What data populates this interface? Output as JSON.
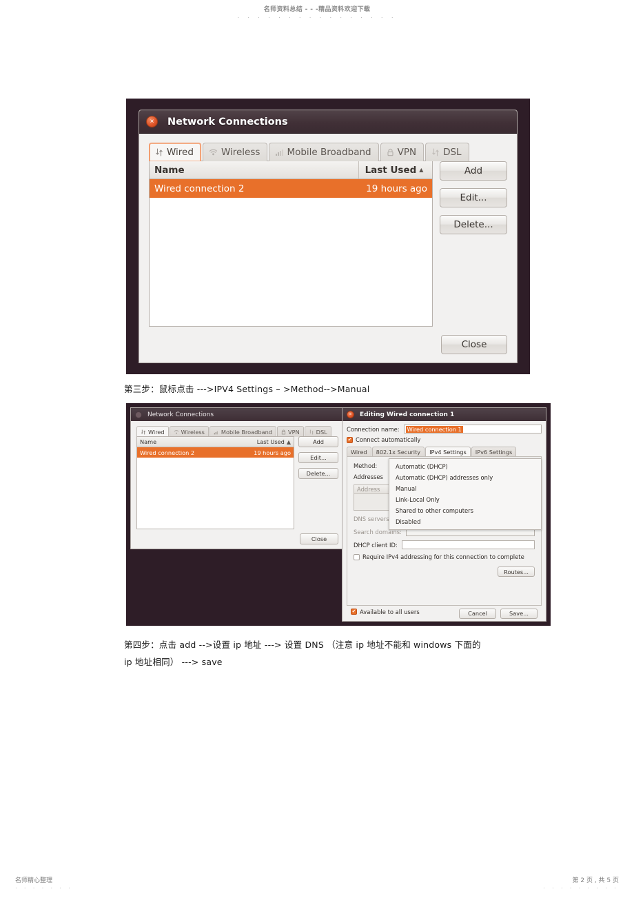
{
  "document": {
    "header_watermark": "名师资料总结 - - -精品资料欢迎下载",
    "header_dots": "· · · · · · · · · · · · · · · ·",
    "footer_left": "名师精心整理",
    "footer_left_dots": "· · · · · · ·",
    "footer_right": "第 2 页 , 共 5 页",
    "footer_right_dots": "· · · · · · · · ·",
    "paragraphs": {
      "step3": "第三步：鼠标点击  --->IPV4 Settings   – >Method-->Manual",
      "step4_line1": "第四步：点击  add  -->设置 ip 地址 ---> 设置 DNS （注意 ip 地址不能和  windows 下面的",
      "step4_line2": "ip 地址相同） ---> save"
    }
  },
  "screenshot1": {
    "window_title": "Network Connections",
    "close_glyph": "×",
    "tabs": [
      {
        "label": "Wired",
        "icon": "wired-icon",
        "active": true
      },
      {
        "label": "Wireless",
        "icon": "wifi-icon",
        "active": false
      },
      {
        "label": "Mobile Broadband",
        "icon": "signal-bars-icon",
        "active": false
      },
      {
        "label": "VPN",
        "icon": "lock-icon",
        "active": false
      },
      {
        "label": "DSL",
        "icon": "wired-icon",
        "active": false
      }
    ],
    "list": {
      "columns": [
        "Name",
        "Last Used"
      ],
      "sort_arrow": "▲",
      "rows": [
        {
          "name": "Wired connection 2",
          "last_used": "19 hours ago",
          "selected": true
        }
      ]
    },
    "buttons": {
      "add": "Add",
      "edit": "Edit...",
      "delete": "Delete...",
      "close": "Close"
    }
  },
  "screenshot2": {
    "left_window": {
      "window_title": "Network Connections",
      "tabs": [
        {
          "label": "Wired",
          "icon": "wired-icon",
          "active": true
        },
        {
          "label": "Wireless",
          "icon": "wifi-icon",
          "active": false
        },
        {
          "label": "Mobile Broadband",
          "icon": "signal-bars-icon",
          "active": false
        },
        {
          "label": "VPN",
          "icon": "lock-icon",
          "active": false
        },
        {
          "label": "DSL",
          "icon": "wired-icon",
          "active": false
        }
      ],
      "list": {
        "columns": [
          "Name",
          "Last Used"
        ],
        "sort_arrow": "▲",
        "rows": [
          {
            "name": "Wired connection 2",
            "last_used": "19 hours ago",
            "selected": true
          }
        ]
      },
      "buttons": {
        "add": "Add",
        "edit": "Edit...",
        "delete": "Delete...",
        "close": "Close"
      }
    },
    "right_window": {
      "window_title": "Editing Wired connection 1",
      "close_glyph": "×",
      "connection_name_label": "Connection name:",
      "connection_name_value": "Wired connection 1",
      "connect_automatically_label": "Connect automatically",
      "connect_automatically_checked": true,
      "check_glyph": "✔",
      "tabs": [
        {
          "label": "Wired",
          "active": false
        },
        {
          "label": "802.1x Security",
          "active": false
        },
        {
          "label": "IPv4 Settings",
          "active": true
        },
        {
          "label": "IPv6 Settings",
          "active": false
        }
      ],
      "method_label": "Method:",
      "method_dropdown_open": true,
      "method_options": [
        "Automatic (DHCP)",
        "Automatic (DHCP) addresses only",
        "Manual",
        "Link-Local Only",
        "Shared to other computers",
        "Disabled"
      ],
      "addresses_label": "Addresses",
      "address_column_header": "Address",
      "dns_servers_label": "DNS servers:",
      "search_domains_label": "Search domains:",
      "dhcp_client_id_label": "DHCP client ID:",
      "dhcp_client_id_value": "",
      "require_ipv4_label": "Require IPv4 addressing for this connection to complete",
      "require_ipv4_checked": false,
      "routes_button": "Routes...",
      "available_to_all_label": "Available to all users",
      "available_to_all_checked": true,
      "cancel_button": "Cancel",
      "save_button": "Save..."
    }
  },
  "colors": {
    "accent_orange": "#e8702a",
    "titlebar_dark": "#3e2e35",
    "desktop_bg": "#2e1d27",
    "window_bg": "#f2f1f0"
  }
}
